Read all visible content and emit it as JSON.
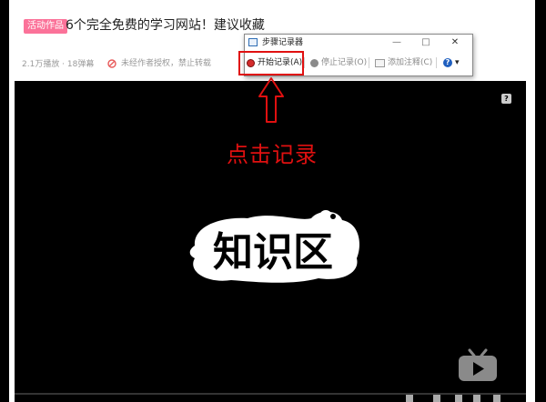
{
  "video": {
    "tag": "活动作品",
    "title": "6个完全免费的学习网站！建议收藏",
    "stats": "2.1万播放 · 18弹幕",
    "warning": "未经作者授权，禁止转载",
    "logo_text": "知识区",
    "progress_fraction": 0.0
  },
  "annotation": {
    "text": "点击记录",
    "color": "#e01010"
  },
  "recorder": {
    "title": "步骤记录器",
    "minimize": "—",
    "maximize": "□",
    "close": "✕",
    "start_label": "开始记录(A)",
    "stop_label": "停止记录(O)",
    "comment_label": "添加注释(C)",
    "help_icon": "help-icon",
    "dropdown": "▾"
  },
  "colors": {
    "accent_pink": "#fb7299",
    "record_red": "#d42c2c",
    "progress_blue": "#00a1d6"
  }
}
